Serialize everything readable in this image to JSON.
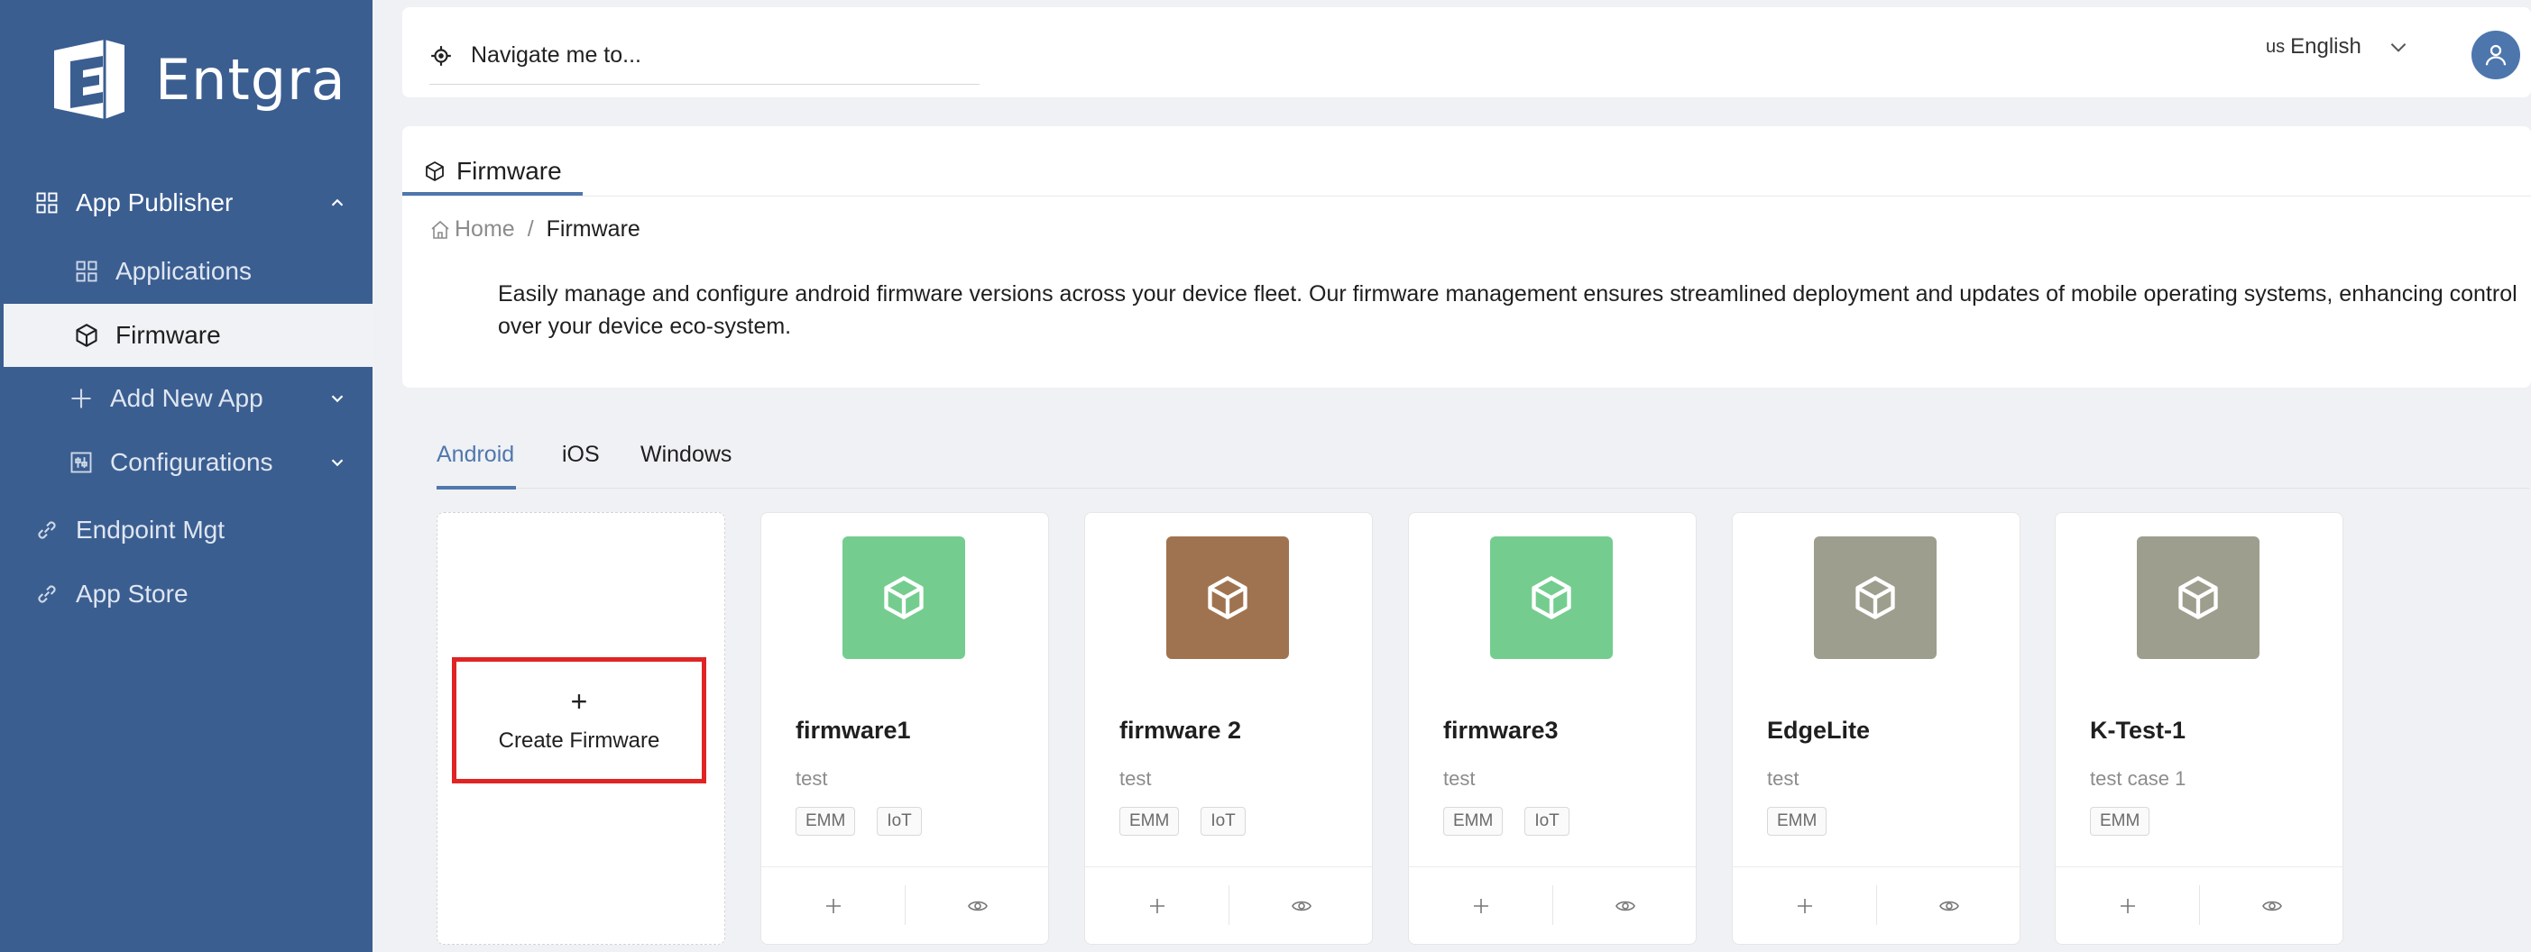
{
  "brand": {
    "name": "Entgra"
  },
  "sidebar": {
    "items": [
      {
        "label": "App Publisher",
        "icon": "grid-icon"
      },
      {
        "label": "Applications",
        "icon": "grid-icon"
      },
      {
        "label": "Firmware",
        "icon": "cube-icon"
      },
      {
        "label": "Add New App",
        "icon": "plus-icon"
      },
      {
        "label": "Configurations",
        "icon": "settings-panel-icon"
      },
      {
        "label": "Endpoint Mgt",
        "icon": "link-icon"
      },
      {
        "label": "App Store",
        "icon": "link-icon"
      }
    ]
  },
  "topbar": {
    "search_placeholder": "Navigate me to...",
    "language_flag": "us",
    "language": "English"
  },
  "page": {
    "tab_label": "Firmware",
    "breadcrumb": {
      "home": "Home",
      "separator": "/",
      "current": "Firmware"
    },
    "description": "Easily manage and configure android firmware versions across your device fleet. Our firmware management ensures streamlined deployment and updates of mobile operating systems, enhancing control over your device eco-system."
  },
  "platform_tabs": [
    "Android",
    "iOS",
    "Windows"
  ],
  "create_card": {
    "plus": "+",
    "label": "Create Firmware"
  },
  "firmwares": [
    {
      "name": "firmware1",
      "description": "test",
      "tags": [
        "EMM",
        "IoT"
      ],
      "icon_color": "#74cd8f"
    },
    {
      "name": "firmware 2",
      "description": "test",
      "tags": [
        "EMM",
        "IoT"
      ],
      "icon_color": "#a07350"
    },
    {
      "name": "firmware3",
      "description": "test",
      "tags": [
        "EMM",
        "IoT"
      ],
      "icon_color": "#74cd8f"
    },
    {
      "name": "EdgeLite",
      "description": "test",
      "tags": [
        "EMM"
      ],
      "icon_color": "#9e9e8e"
    },
    {
      "name": "K-Test-1",
      "description": "test case 1",
      "tags": [
        "EMM"
      ],
      "icon_color": "#9e9e8e"
    }
  ],
  "colors": {
    "sidebar": "#3b5e91",
    "accent": "#4f77ad",
    "highlight": "#e02424"
  }
}
